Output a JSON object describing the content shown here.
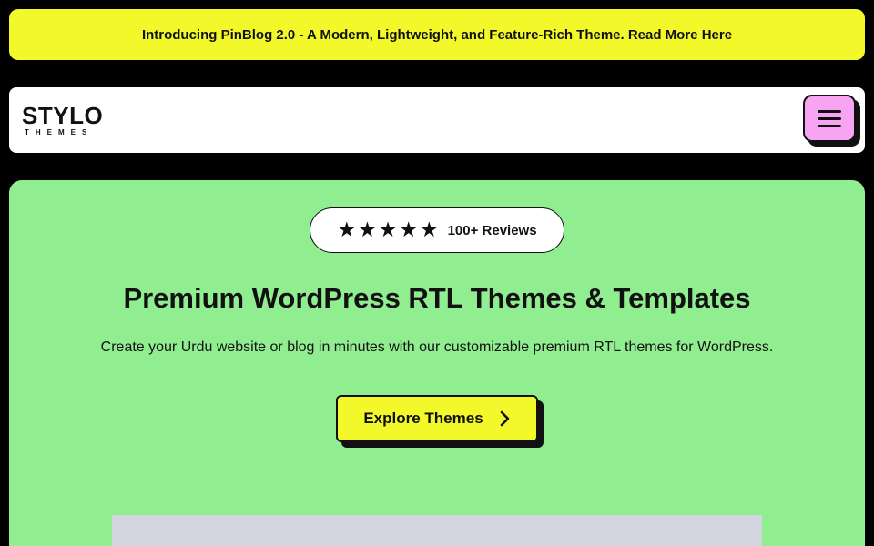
{
  "announcement": {
    "text": "Introducing PinBlog 2.0 - A Modern, Lightweight, and Feature-Rich Theme. Read More Here"
  },
  "header": {
    "logo_word": "STYLO",
    "logo_sub": "THEMES",
    "menu_icon": "hamburger-icon"
  },
  "hero": {
    "rating_stars": 5,
    "reviews_label": "100+ Reviews",
    "title": "Premium WordPress RTL Themes & Templates",
    "subtitle": "Create your Urdu website or blog in minutes with our customizable premium RTL themes for WordPress.",
    "cta_label": "Explore Themes",
    "cta_icon": "chevron-right-icon"
  },
  "colors": {
    "announcement_bg": "#f3f82a",
    "hero_bg": "#90ee90",
    "menu_button_bg": "#f7a4f2",
    "cta_bg": "#f3f82a",
    "page_bg": "#000000"
  }
}
